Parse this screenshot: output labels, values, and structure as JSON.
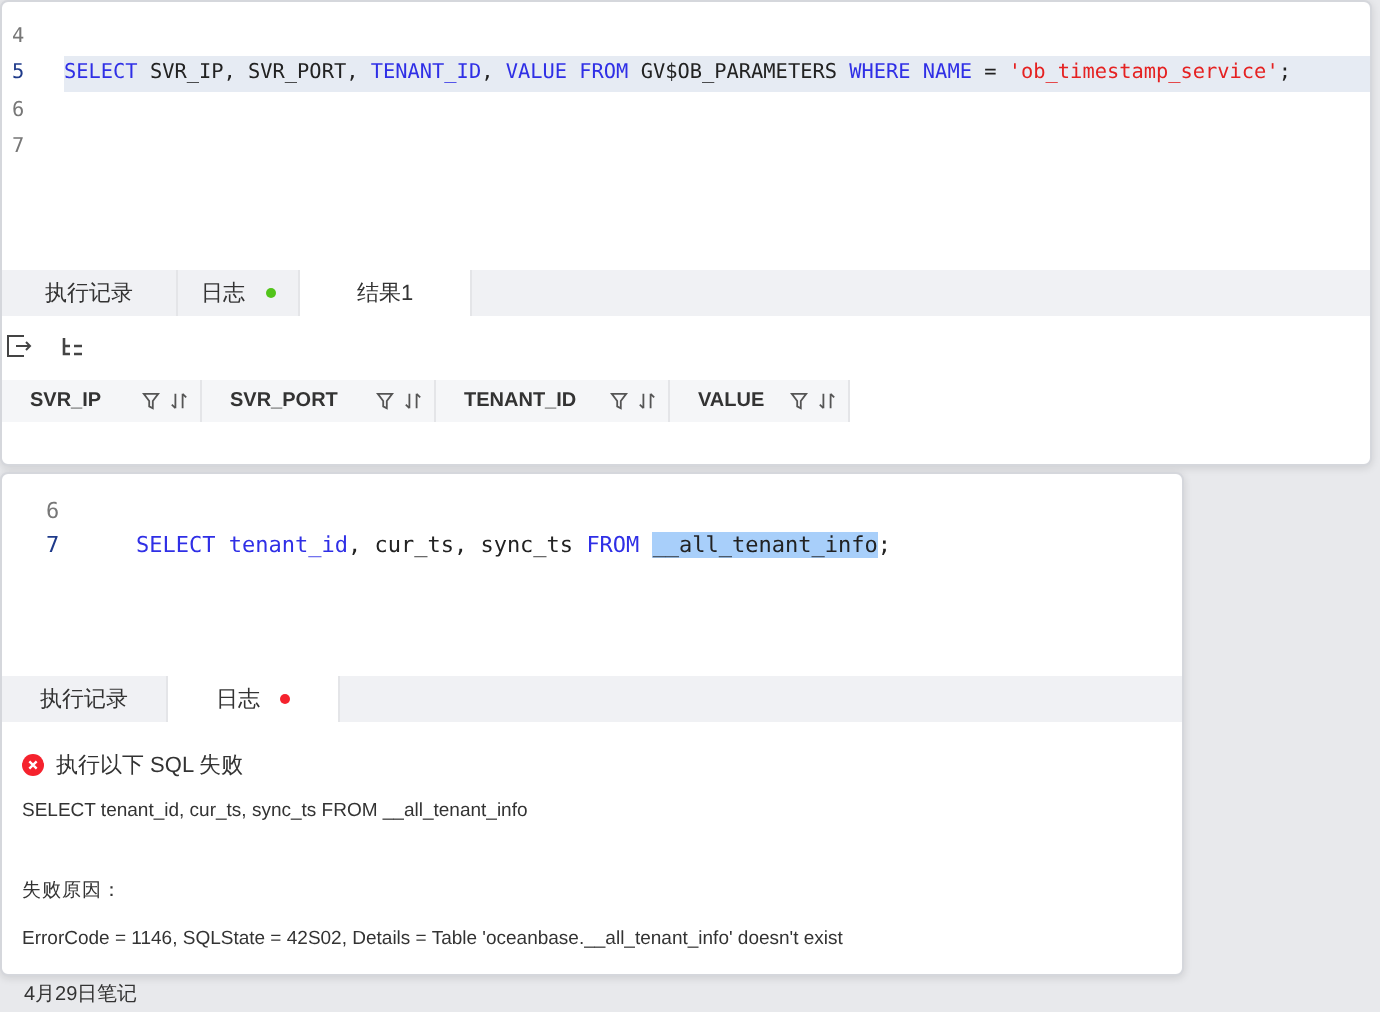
{
  "top_panel": {
    "editor_lines": [
      {
        "number": "4",
        "highlighted": false
      },
      {
        "number": "5",
        "highlighted": true,
        "tokens": [
          {
            "kind": "keyword",
            "text": "SELECT"
          },
          {
            "kind": "text",
            "text": "SVR_IP, SVR_PORT,"
          },
          {
            "kind": "keyword",
            "text": "TENANT_ID"
          },
          {
            "kind": "text",
            "text": ","
          },
          {
            "kind": "keyword",
            "text": "VALUE FROM"
          },
          {
            "kind": "text",
            "text": "GV$OB_PARAMETERS"
          },
          {
            "kind": "keyword",
            "text": "WHERE NAME"
          },
          {
            "kind": "text",
            "text": "="
          },
          {
            "kind": "string",
            "text": "'ob_timestamp_service'"
          },
          {
            "kind": "text",
            "text": ";"
          }
        ]
      },
      {
        "number": "6",
        "highlighted": false
      },
      {
        "number": "7",
        "highlighted": false
      }
    ],
    "tabs": [
      {
        "label": "执行记录",
        "selected": false
      },
      {
        "label": "日志",
        "selected": false,
        "color": "#52c41a"
      },
      {
        "label": "结果1",
        "selected": true
      }
    ],
    "columns": [
      "SVR_IP",
      "SVR_PORT",
      "TENANT_ID",
      "VALUE"
    ]
  },
  "bottom_panel": {
    "editor_lines": [
      {
        "number": "6",
        "highlighted": false
      },
      {
        "number": "7",
        "highlighted": false,
        "tokens": [
          {
            "kind": "keyword",
            "text": "SELECT tenant_id"
          },
          {
            "kind": "text",
            "text": ", cur_ts, sync_ts"
          },
          {
            "kind": "keyword",
            "text": "FROM"
          },
          {
            "kind": "selected",
            "text": "__all_tenant_info"
          },
          {
            "kind": "text",
            "text": ";"
          }
        ]
      }
    ],
    "tabs": [
      {
        "label": "执行记录",
        "selected": false
      },
      {
        "label": "日志",
        "selected": true,
        "color": "#f5222d"
      }
    ],
    "log": {
      "title": "执行以下 SQL 失败",
      "sql": "SELECT tenant_id, cur_ts, sync_ts FROM __all_tenant_info",
      "reason_label": "失败原因：",
      "reason": "ErrorCode = 1146, SQLState = 42S02, Details = Table 'oceanbase.__all_tenant_info' doesn't exist"
    }
  },
  "footer_note": "4月29日笔记"
}
